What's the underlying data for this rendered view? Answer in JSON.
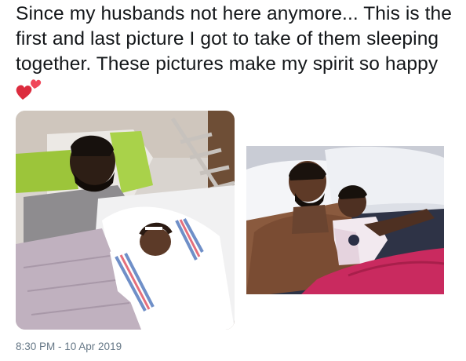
{
  "tweet": {
    "text": "Since my husbands not here anymore... This is the first and last picture I got to take of them sleeping together. These pictures make my spirit so happy",
    "emoji": "two-hearts-icon"
  },
  "media": [
    {
      "name": "photo-father-newborn"
    },
    {
      "name": "photo-father-daughter"
    }
  ],
  "timestamp": "8:30 PM - 10 Apr 2019",
  "colors": {
    "text": "#14171a",
    "secondary": "#657786",
    "heart": "#e8344a"
  }
}
